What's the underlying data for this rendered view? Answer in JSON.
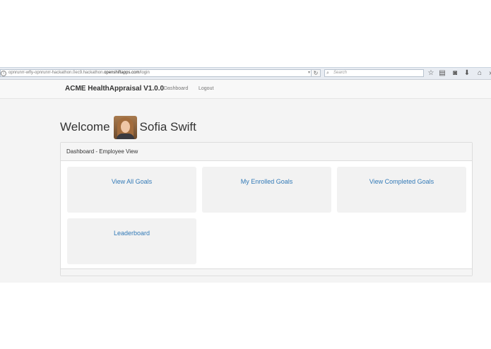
{
  "browser": {
    "url_prefix": "opnrunrr-wfly-opnrunrr-hackathon.0ec9.hackathon.",
    "url_host": "openshiftapps.com",
    "url_suffix": "/login",
    "search_placeholder": "Search"
  },
  "navbar": {
    "brand": "ACME HealthAppraisal V1.0.0",
    "links": [
      "Dashboard",
      "Logout"
    ]
  },
  "welcome": {
    "greeting": "Welcome",
    "user_name": "Sofia Swift"
  },
  "panel": {
    "heading": "Dashboard - Employee View",
    "tiles": [
      "View All Goals",
      "My Enrolled Goals",
      "View Completed Goals",
      "Leaderboard"
    ]
  },
  "colors": {
    "link": "#337ab7",
    "tile_bg": "#f2f2f2",
    "page_bg": "#f4f4f4"
  }
}
